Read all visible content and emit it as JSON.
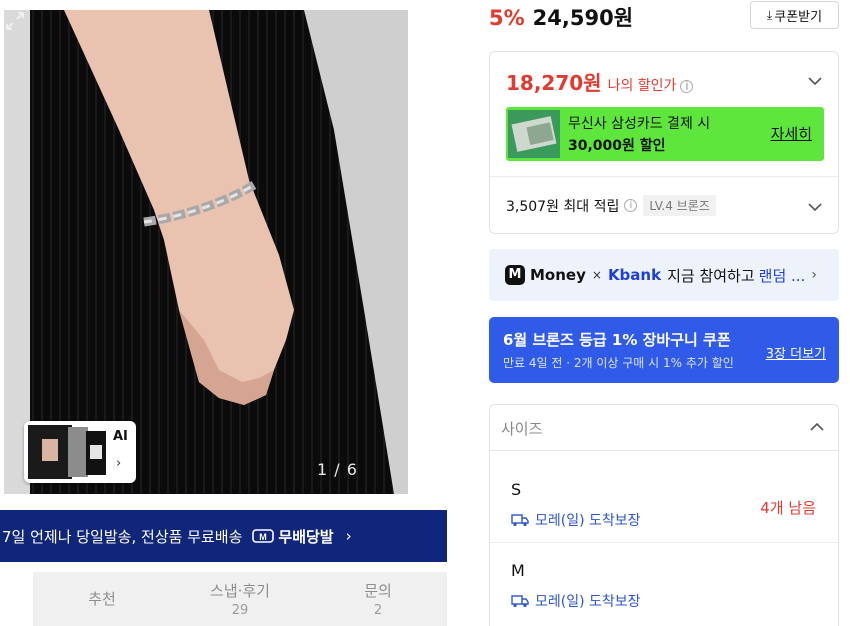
{
  "gallery": {
    "ai_label": "AI",
    "page_indicator": "1 / 6"
  },
  "shipping_banner": {
    "text": "7일 언제나 당일발송, 전상품 무료배송",
    "badge": "무배당발"
  },
  "tabs": [
    {
      "label": "추천",
      "count": ""
    },
    {
      "label": "스냅·후기",
      "count": "29"
    },
    {
      "label": "문의",
      "count": "2"
    }
  ],
  "price": {
    "discount": "5%",
    "amount": "24,590원",
    "coupon_button": "쿠폰받기"
  },
  "my_price": {
    "amount": "18,270원",
    "label": "나의 할인가"
  },
  "card_promo": {
    "line1": "무신사 삼성카드 결제 시",
    "line2": "30,000원 할인",
    "detail_link": "자세히",
    "background_color": "#5ee63c"
  },
  "points": {
    "text": "3,507원 최대 적립",
    "level": "LV.4 브론즈"
  },
  "money_banner": {
    "money": "Money",
    "times": "×",
    "kbank": "Kbank",
    "text": "지금 참여하고",
    "highlight": "랜덤 ..."
  },
  "coupon_banner": {
    "title": "6월 브론즈 등급 1% 장바구니 쿠폰",
    "subtitle": "만료 4일 전 · 2개 이상 구매 시 1% 추가 할인",
    "link": "3장 더보기",
    "background_color": "#2f5be8"
  },
  "size_select": {
    "placeholder": "사이즈",
    "options": [
      {
        "name": "S",
        "shipping": "모레(일) 도착보장",
        "stock": "4개 남음"
      },
      {
        "name": "M",
        "shipping": "모레(일) 도착보장",
        "stock": ""
      }
    ]
  },
  "colors": {
    "accent_red": "#e03b2e",
    "navy": "#10267a",
    "link_blue": "#2c55c8"
  }
}
